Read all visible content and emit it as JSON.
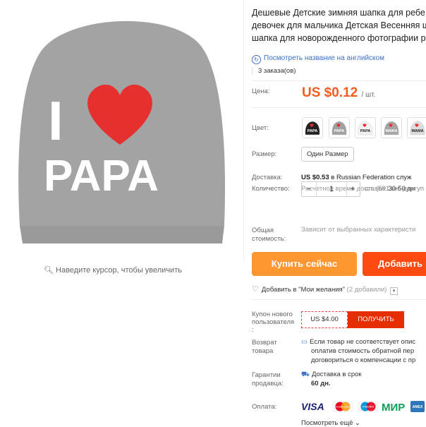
{
  "gallery": {
    "hat_text_top": "I",
    "hat_text_bottom": "PAPA",
    "zoom_hint": "Наведите курсор, чтобы увеличить"
  },
  "product": {
    "title_lines": [
      "Дешевые Детские зимняя шапка для ребе",
      "девочек для мальчика Детская Весенняя ш",
      "шапка для новорожденного фотографии р"
    ],
    "translate_link": "Посмотреть название на английском",
    "orders": "3 заказа(ов)"
  },
  "price": {
    "label": "Цена:",
    "value": "US $0.12",
    "unit": "/ шт."
  },
  "color": {
    "label": "Цвет:",
    "swatches": [
      {
        "name": "black-papa",
        "hat": "#222222",
        "text": "PAPA"
      },
      {
        "name": "gray-papa",
        "hat": "#a0a0a0",
        "text": "PAPA"
      },
      {
        "name": "white-papa",
        "hat": "#f2f2f2",
        "text": "PAPA"
      },
      {
        "name": "gray-mama",
        "hat": "#a5a5a5",
        "text": "MAMA"
      },
      {
        "name": "light-mama",
        "hat": "#dcdcdc",
        "text": "MAMA"
      }
    ]
  },
  "size": {
    "label": "Размер:",
    "option": "Один Размер"
  },
  "shipping": {
    "label": "Доставка:",
    "cost": "US $0.53",
    "to": "в Russian Federation служ",
    "time_label": "Расчетное время доставки:",
    "time_value": "30-50 дн"
  },
  "quantity": {
    "label": "Количество:",
    "minus": "−",
    "value": "1",
    "plus": "+",
    "note": "шт. (591 шт. доступ"
  },
  "total": {
    "label_line1": "Общая",
    "label_line2": "стоимость:",
    "note": "Зависит от выбранных характеристи"
  },
  "actions": {
    "buy_now": "Купить сейчас",
    "add_to_cart": "Добавить"
  },
  "wishlist": {
    "text": "Добавить в \"Мои желания\"",
    "count": "(2 добавили)"
  },
  "coupon": {
    "label_line1": "Купон нового",
    "label_line2": "пользователя",
    "label_line3": ":",
    "value": "US $4.00",
    "button": "ПОЛУЧИТЬ"
  },
  "returns": {
    "label_line1": "Возврат",
    "label_line2": "товара",
    "lines": [
      "Если товар не соответствует опис",
      "оплатив стоимость обратной пер",
      "договориться о компенсации с пр"
    ]
  },
  "guarantee": {
    "label_line1": "Гарантии",
    "label_line2": "продавца:",
    "line1": "Доставка в срок",
    "line2": "60 дн."
  },
  "payment": {
    "label": "Оплата:",
    "methods": [
      "VISA",
      "mastercard",
      "maestro",
      "МИР",
      "AMEX"
    ]
  },
  "more": "Посмотреть ещё"
}
